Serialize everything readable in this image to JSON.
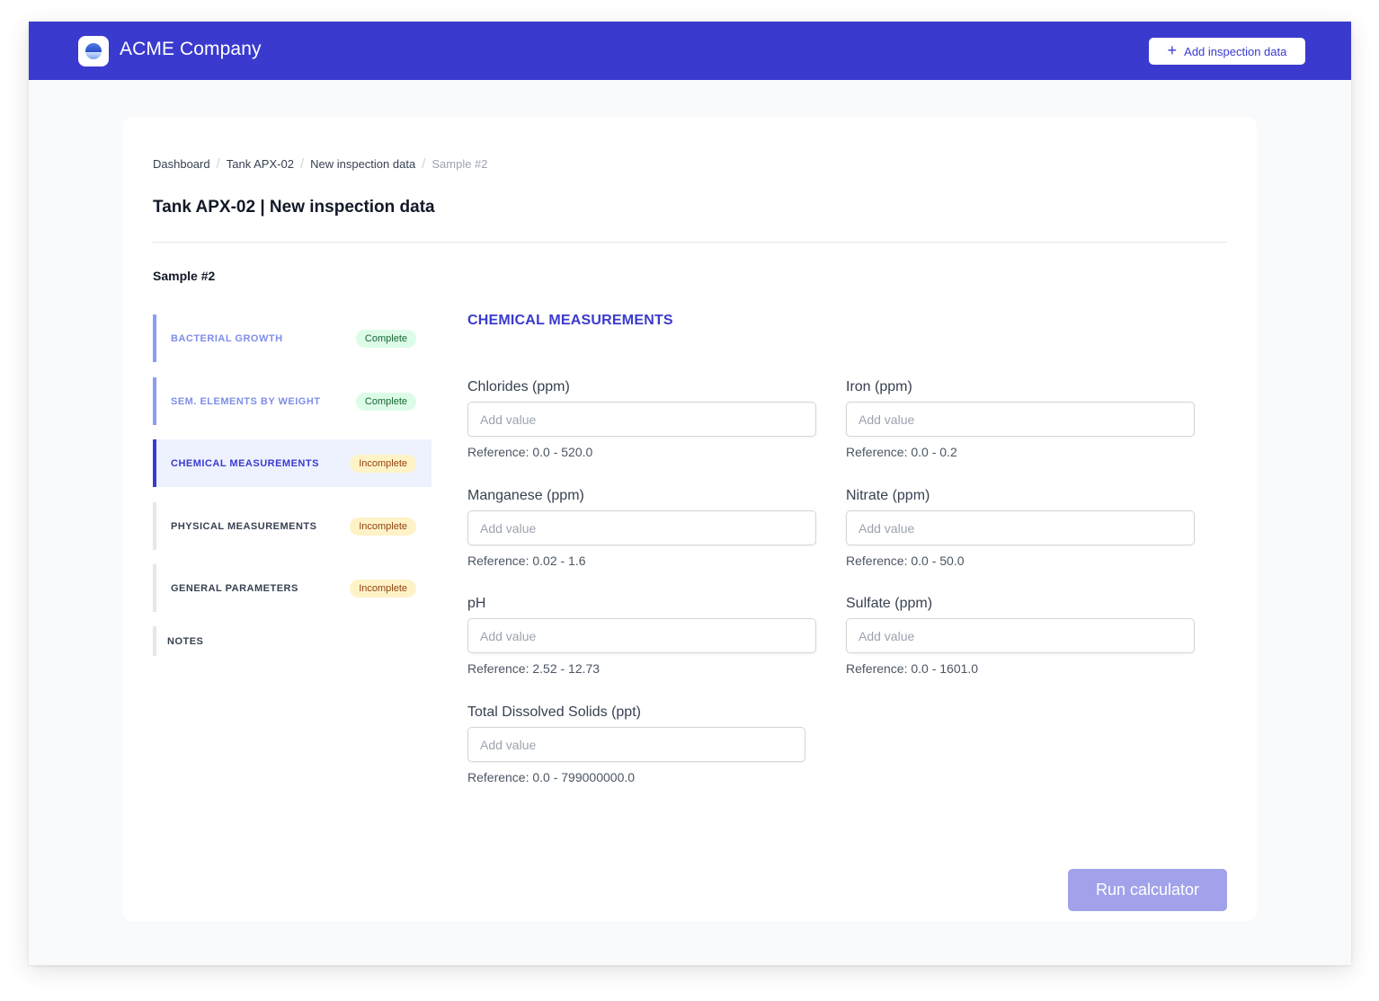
{
  "header": {
    "brand": "ACME Company",
    "logo_icon": "logo-icon",
    "add_button_label": "Add inspection data",
    "accent_color": "#3a3acf"
  },
  "breadcrumb": [
    "Dashboard",
    "Tank APX-02",
    "New inspection data",
    "Sample #2"
  ],
  "page_title": "Tank APX-02 | New inspection data",
  "sample_title": "Sample #2",
  "steps": [
    {
      "label": "BACTERIAL GROWTH",
      "status": "Complete"
    },
    {
      "label": "SEM. ELEMENTS BY WEIGHT",
      "status": "Complete"
    },
    {
      "label": "CHEMICAL MEASUREMENTS",
      "status": "Incomplete"
    },
    {
      "label": "PHYSICAL MEASUREMENTS",
      "status": "Incomplete"
    },
    {
      "label": "GENERAL PARAMETERS",
      "status": "Incomplete"
    },
    {
      "label": "NOTES",
      "status": ""
    }
  ],
  "section_title": "CHEMICAL MEASUREMENTS",
  "fields": [
    {
      "label": "Chlorides (ppm)",
      "placeholder": "Add value",
      "value": "",
      "reference": "Reference: 0.0 - 520.0"
    },
    {
      "label": "Iron (ppm)",
      "placeholder": "Add value",
      "value": "",
      "reference": "Reference: 0.0 - 0.2"
    },
    {
      "label": "Manganese (ppm)",
      "placeholder": "Add value",
      "value": "",
      "reference": "Reference: 0.02 - 1.6"
    },
    {
      "label": "Nitrate (ppm)",
      "placeholder": "Add value",
      "value": "",
      "reference": "Reference: 0.0 - 50.0"
    },
    {
      "label": "pH",
      "placeholder": "Add value",
      "value": "",
      "reference": "Reference: 2.52 - 12.73"
    },
    {
      "label": "Sulfate (ppm)",
      "placeholder": "Add value",
      "value": "",
      "reference": "Reference: 0.0 - 1601.0"
    },
    {
      "label": "Total Dissolved Solids (ppt)",
      "placeholder": "Add value",
      "value": "",
      "reference": "Reference: 0.0 - 799000000.0"
    }
  ],
  "run_button_label": "Run calculator"
}
